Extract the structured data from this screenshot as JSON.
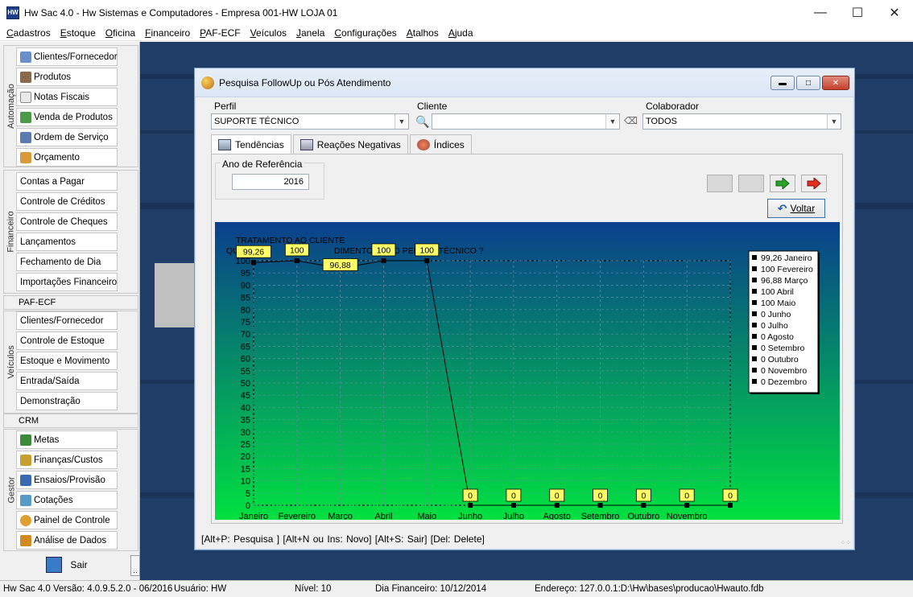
{
  "window": {
    "title": "Hw Sac 4.0 - Hw Sistemas e Computadores - Empresa 001-HW LOJA 01"
  },
  "menu": [
    "Cadastros",
    "Estoque",
    "Oficina",
    "Financeiro",
    "PAF-ECF",
    "Veículos",
    "Janela",
    "Configurações",
    "Atalhos",
    "Ajuda"
  ],
  "sidebar": {
    "groups": {
      "automacao": "Automação",
      "financeiro": "Financeiro",
      "paf": "PAF-ECF",
      "veiculos": "Veículos",
      "crm": "CRM",
      "gestor": "Gestor"
    },
    "automacao_items": [
      "Clientes/Fornecedor",
      "Produtos",
      "Notas Fiscais",
      "Venda de Produtos",
      "Ordem de Serviço",
      "Orçamento"
    ],
    "financeiro_items": [
      "Contas a Pagar",
      "Controle de Créditos",
      "Controle de Cheques",
      "Lançamentos",
      "Fechamento de Dia",
      "Importações Financeiro"
    ],
    "veiculos_items": [
      "Clientes/Fornecedor",
      "Controle de Estoque",
      "Estoque e Movimento",
      "Entrada/Saída",
      "Demonstração"
    ],
    "gestor_items": [
      "Metas",
      "Finanças/Custos",
      "Ensaios/Provisão",
      "Cotações",
      "Painel de Controle",
      "Análise de Dados"
    ],
    "sair": "Sair",
    "more": ".."
  },
  "dialog": {
    "title": "Pesquisa FollowUp ou Pós Atendimento",
    "perfil_label": "Perfil",
    "perfil_value": "SUPORTE TÉCNICO",
    "cliente_label": "Cliente",
    "cliente_value": "",
    "colaborador_label": "Colaborador",
    "colaborador_value": "TODOS",
    "tabs": [
      "Tendências",
      "Reações Negativas",
      "Índices"
    ],
    "ano_label": "Ano de Referência",
    "ano_value": "2016",
    "voltar": "Voltar",
    "shortcuts": "[Alt+P: Pesquisa ]   [Alt+N ou Ins: Novo]   [Alt+S: Sair]   [Del: Delete]"
  },
  "chart_data": {
    "type": "line",
    "title": "TRATAMENTO AO CLIENTE",
    "subtitle": "O(A) ... PELO(A) TÉCNICO ?",
    "title_partial": [
      "QUAL",
      "E",
      "S",
      "A",
      "NO",
      "DIMENTO FEITO PELO(A) TÉCNICO ?"
    ],
    "categories": [
      "Janeiro",
      "Fevereiro",
      "Março",
      "Abril",
      "Maio",
      "Junho",
      "Julho",
      "Agosto",
      "Setembro",
      "Outubro",
      "Novembro",
      "Dezembro"
    ],
    "x_tick_labels": [
      "Janeiro",
      "Fevereiro",
      "Março",
      "Abril",
      "Maio",
      "Junho",
      "Julho",
      "Agosto",
      "Setembro",
      "Outubro",
      "Novembro"
    ],
    "values": [
      99.26,
      100,
      96.88,
      100,
      100,
      0,
      0,
      0,
      0,
      0,
      0,
      0
    ],
    "data_labels": [
      "99,26",
      "100",
      "96,88",
      "100",
      "100",
      "0",
      "0",
      "0",
      "0",
      "0",
      "0",
      "0"
    ],
    "legend": [
      "99,26 Janeiro",
      "100 Fevereiro",
      "96,88 Março",
      "100 Abril",
      "100 Maio",
      "0 Junho",
      "0 Julho",
      "0 Agosto",
      "0 Setembro",
      "0 Outubro",
      "0 Novembro",
      "0 Dezembro"
    ],
    "ylim": [
      0,
      100
    ],
    "yticks": [
      0,
      5,
      10,
      15,
      20,
      25,
      30,
      35,
      40,
      45,
      50,
      55,
      60,
      65,
      70,
      75,
      80,
      85,
      90,
      95,
      100
    ],
    "grid": true,
    "legend_position": "right",
    "colors": {
      "bg_top": "#0a3f8c",
      "bg_bottom": "#00e040",
      "line": "#000000",
      "label_bg": "#ffff66"
    }
  },
  "statusbar": {
    "versao": "Hw Sac 4.0 Versão: 4.0.9.5.2.0 - 06/2016",
    "usuario": "Usuário: HW",
    "nivel": "Nível: 10",
    "dia": "Dia Financeiro: 10/12/2014",
    "endereco": "Endereço: 127.0.0.1:D:\\Hw\\bases\\producao\\Hwauto.fdb"
  }
}
